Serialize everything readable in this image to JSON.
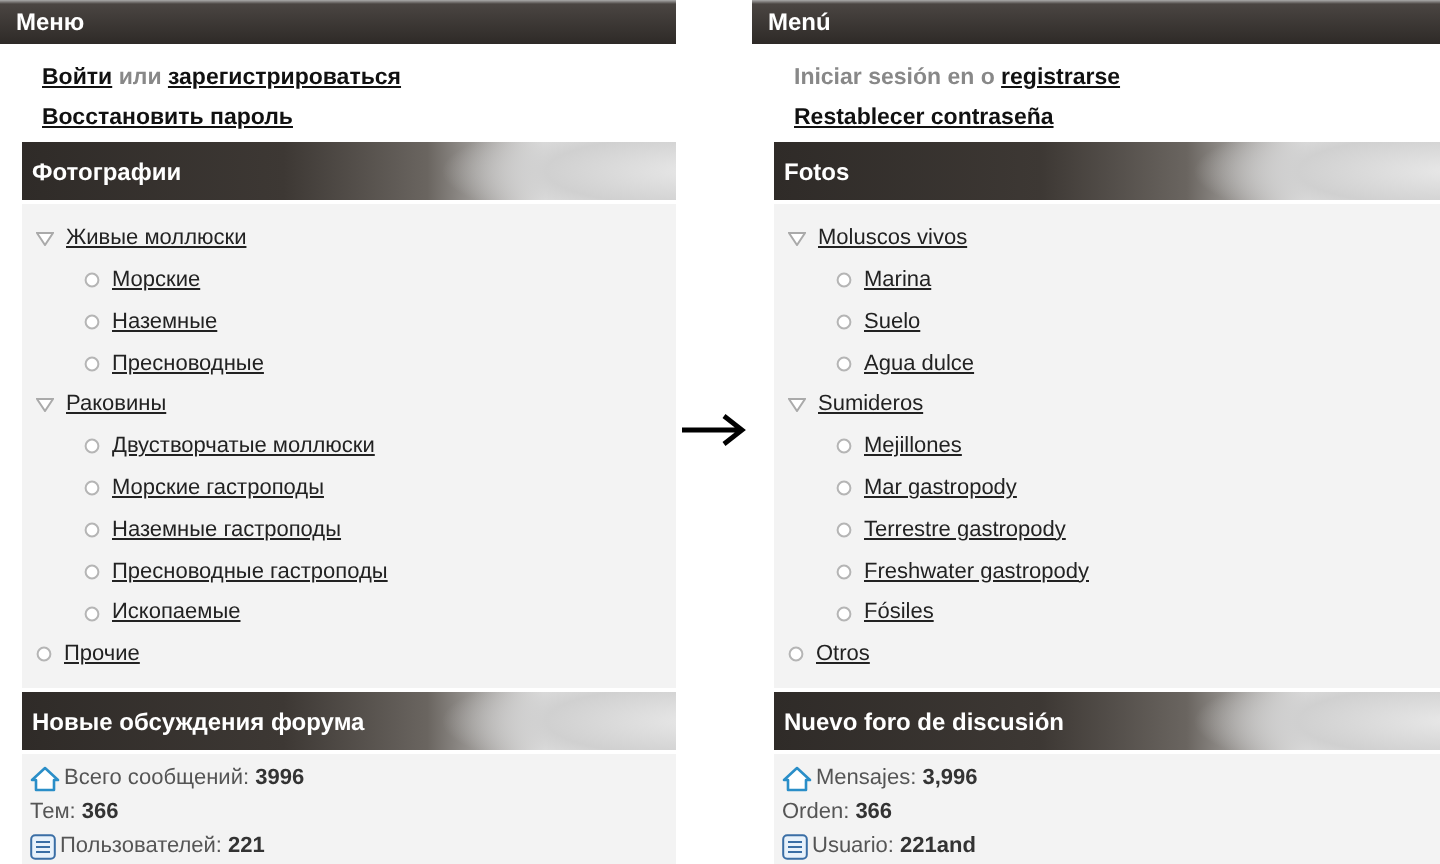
{
  "panels": [
    {
      "menu": {
        "title": "Меню",
        "auth_line": [
          {
            "kind": "link",
            "text": "Войти"
          },
          {
            "kind": "text",
            "text": "или"
          },
          {
            "kind": "link",
            "text": "зарегистрироваться"
          }
        ],
        "reset_link": "Восстановить пароль"
      },
      "photos": {
        "title": "Фотографии",
        "items": [
          {
            "kind": "group",
            "label": "Живые моллюски",
            "children": [
              {
                "kind": "leaf",
                "label": "Морские"
              },
              {
                "kind": "leaf",
                "label": "Наземные"
              },
              {
                "kind": "leaf",
                "label": "Пресноводные"
              }
            ]
          },
          {
            "kind": "group",
            "label": "Раковины",
            "children": [
              {
                "kind": "leaf",
                "label": "Двустворчатые моллюски"
              },
              {
                "kind": "leaf",
                "label": "Морские гастроподы"
              },
              {
                "kind": "leaf",
                "label": "Наземные гастроподы"
              },
              {
                "kind": "leaf",
                "label": "Пресноводные гастроподы"
              },
              {
                "kind": "leaf",
                "label": "Ископаемые"
              }
            ]
          },
          {
            "kind": "leaf",
            "label": "Прочие"
          }
        ]
      },
      "forum": {
        "title": "Новые обсуждения форума",
        "stats": [
          {
            "kind": "messages",
            "text": "Всего сообщений: **3996**"
          },
          {
            "kind": "topics",
            "text": "Тем: **366**"
          },
          {
            "kind": "users",
            "text": "Пользователей: **221**"
          }
        ]
      }
    },
    {
      "menu": {
        "title": "Menú",
        "auth_line": [
          {
            "kind": "text",
            "text": "Iniciar sesión en o"
          },
          {
            "kind": "link",
            "text": "registrarse"
          }
        ],
        "reset_link": "Restablecer contraseña"
      },
      "photos": {
        "title": "Fotos",
        "items": [
          {
            "kind": "group",
            "label": "Moluscos vivos",
            "children": [
              {
                "kind": "leaf",
                "label": "Marina"
              },
              {
                "kind": "leaf",
                "label": "Suelo"
              },
              {
                "kind": "leaf",
                "label": "Agua dulce"
              }
            ]
          },
          {
            "kind": "group",
            "label": "Sumideros",
            "children": [
              {
                "kind": "leaf",
                "label": "Mejillones"
              },
              {
                "kind": "leaf",
                "label": "Mar gastropody"
              },
              {
                "kind": "leaf",
                "label": "Terrestre gastropody"
              },
              {
                "kind": "leaf",
                "label": "Freshwater gastropody"
              },
              {
                "kind": "leaf",
                "label": "Fósiles"
              }
            ]
          },
          {
            "kind": "leaf",
            "label": "Otros"
          }
        ]
      },
      "forum": {
        "title": "Nuevo foro de discusión",
        "stats": [
          {
            "kind": "messages",
            "text": "Mensajes: **3,996**"
          },
          {
            "kind": "topics",
            "text": "Orden: **366**"
          },
          {
            "kind": "users",
            "text": "Usuario: **221and**"
          }
        ]
      }
    }
  ]
}
